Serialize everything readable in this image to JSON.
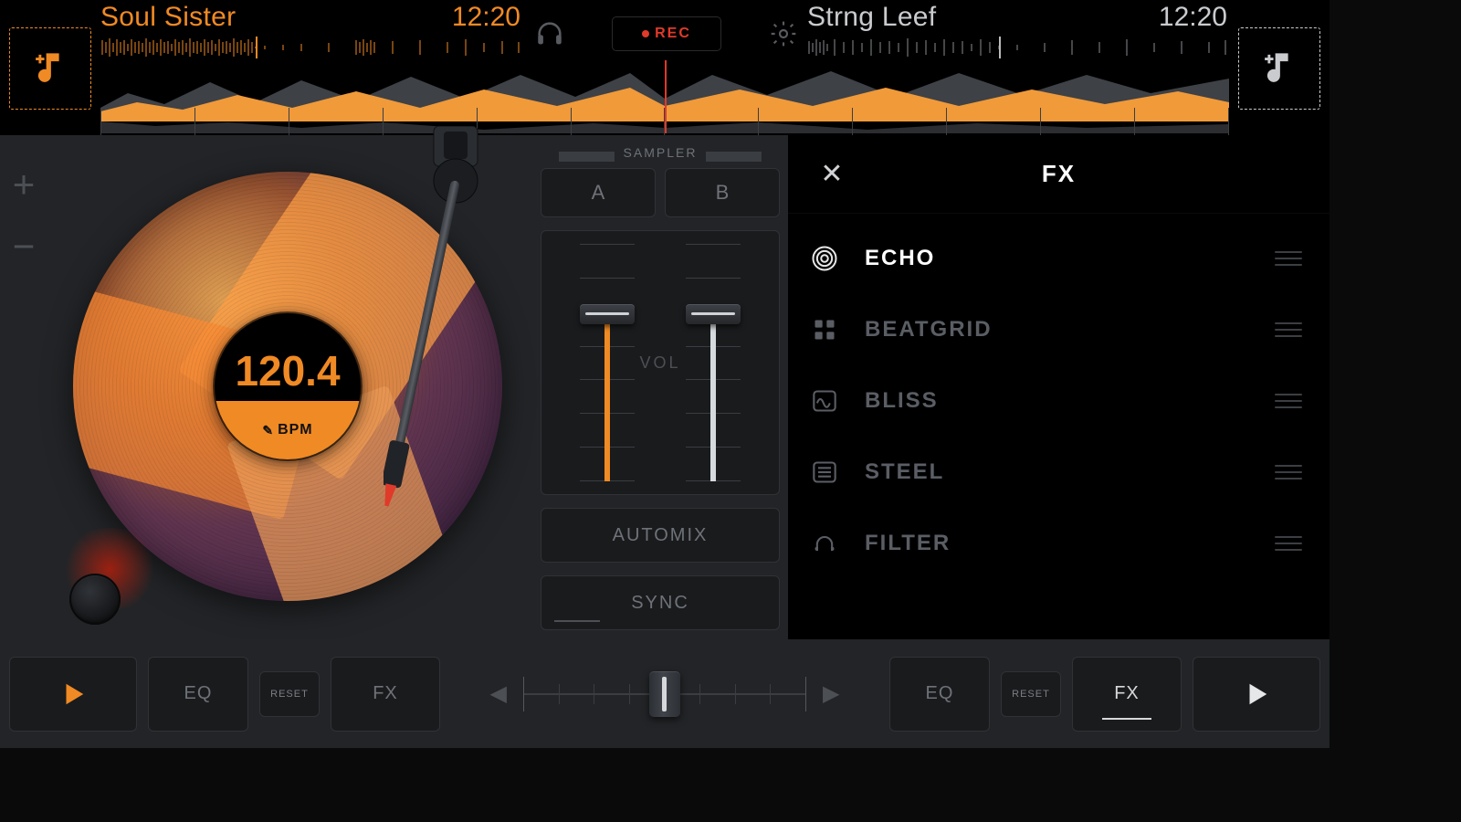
{
  "deck_a": {
    "track_name": "Soul Sister",
    "time": "12:20",
    "bpm_value": "120.4",
    "bpm_label": "BPM"
  },
  "deck_b": {
    "track_name": "Strng Leef",
    "time": "12:20"
  },
  "top": {
    "rec_label": "REC"
  },
  "mixer": {
    "sampler_label": "SAMPLER",
    "sampler_a": "A",
    "sampler_b": "B",
    "vol_label": "VOL",
    "automix": "AUTOMIX",
    "sync": "SYNC"
  },
  "fx_panel": {
    "title": "FX",
    "items": [
      {
        "name": "ECHO",
        "icon": "spiral",
        "active": true
      },
      {
        "name": "BEATGRID",
        "icon": "grid",
        "active": false
      },
      {
        "name": "BLISS",
        "icon": "wave",
        "active": false
      },
      {
        "name": "STEEL",
        "icon": "lines",
        "active": false
      },
      {
        "name": "FILTER",
        "icon": "omega",
        "active": false
      }
    ]
  },
  "bottom": {
    "eq": "EQ",
    "reset": "RESET",
    "fx": "FX"
  }
}
